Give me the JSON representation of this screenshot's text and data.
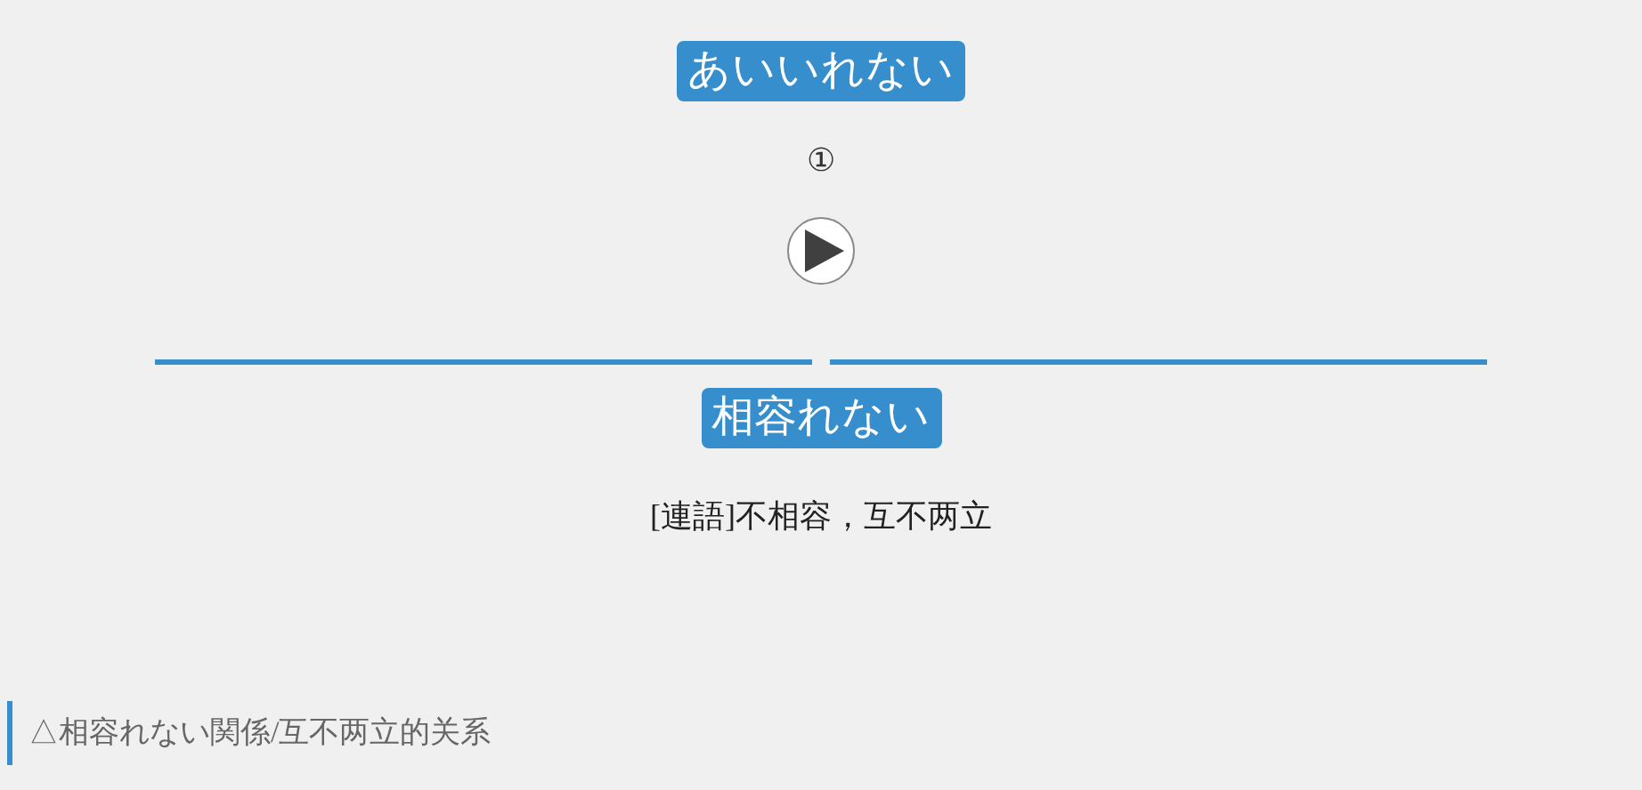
{
  "reading": "あいいれない",
  "sense_number": "①",
  "headword": "相容れない",
  "definition": "[連語]不相容，互不两立",
  "example": "△相容れない関係/互不两立的关系"
}
